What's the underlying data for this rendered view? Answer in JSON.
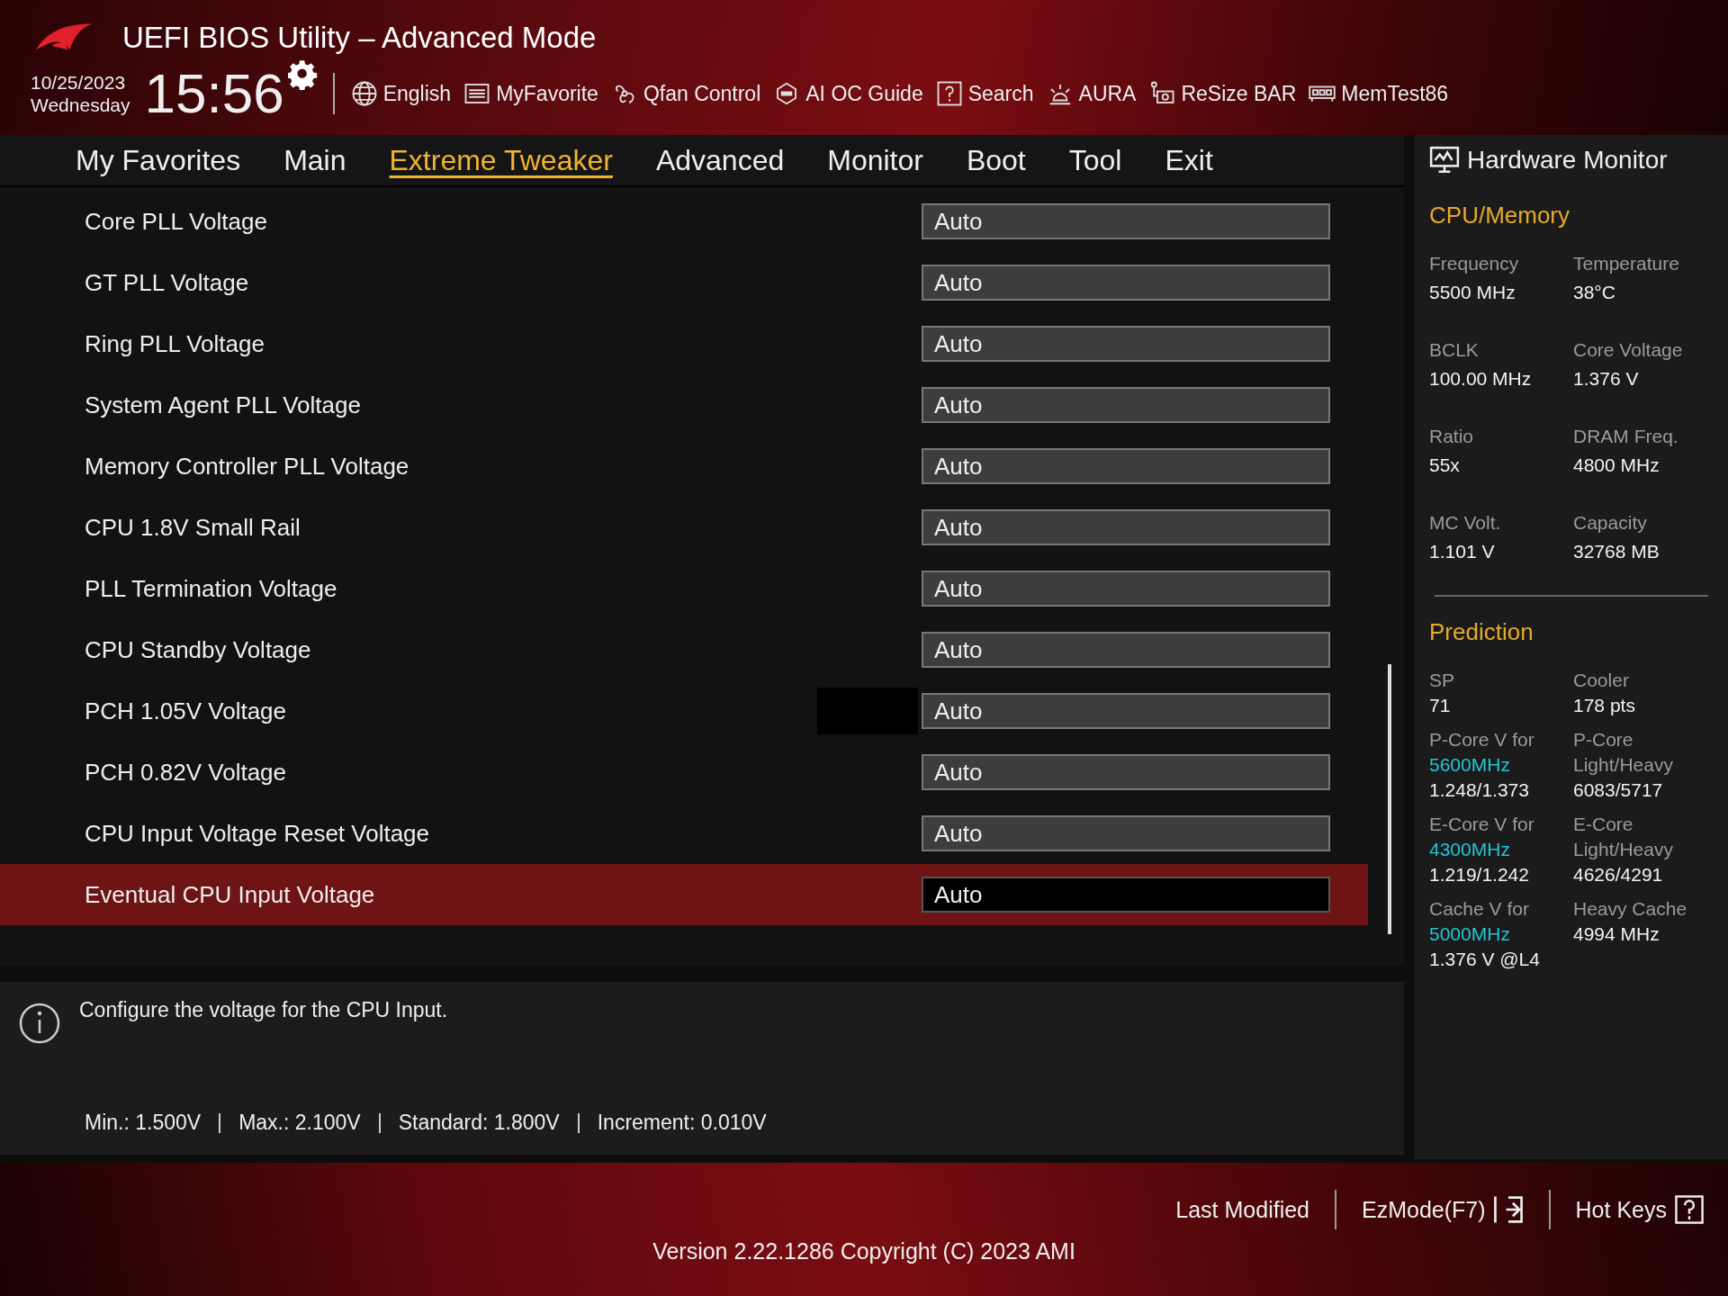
{
  "header": {
    "title": "UEFI BIOS Utility – Advanced Mode",
    "date": "10/25/2023",
    "weekday": "Wednesday",
    "time": "15:56",
    "tools": [
      {
        "kind": "globe",
        "label": "English"
      },
      {
        "kind": "list",
        "label": "MyFavorite"
      },
      {
        "kind": "fan",
        "label": "Qfan Control"
      },
      {
        "kind": "chip",
        "label": "AI OC Guide"
      },
      {
        "kind": "help",
        "label": "Search"
      },
      {
        "kind": "light",
        "label": "AURA"
      },
      {
        "kind": "card",
        "label": "ReSize BAR"
      },
      {
        "kind": "memory",
        "label": "MemTest86"
      }
    ]
  },
  "tabs": [
    {
      "label": "My Favorites",
      "selected": false
    },
    {
      "label": "Main",
      "selected": false
    },
    {
      "label": "Extreme Tweaker",
      "selected": true
    },
    {
      "label": "Advanced",
      "selected": false
    },
    {
      "label": "Monitor",
      "selected": false
    },
    {
      "label": "Boot",
      "selected": false
    },
    {
      "label": "Tool",
      "selected": false
    },
    {
      "label": "Exit",
      "selected": false
    }
  ],
  "settings": [
    {
      "label": "Core PLL Voltage",
      "value": "Auto",
      "selected": false
    },
    {
      "label": "GT PLL Voltage",
      "value": "Auto",
      "selected": false
    },
    {
      "label": "Ring PLL Voltage",
      "value": "Auto",
      "selected": false
    },
    {
      "label": "System Agent PLL Voltage",
      "value": "Auto",
      "selected": false
    },
    {
      "label": "Memory Controller PLL Voltage",
      "value": "Auto",
      "selected": false
    },
    {
      "label": "CPU 1.8V Small Rail",
      "value": "Auto",
      "selected": false
    },
    {
      "label": "PLL Termination Voltage",
      "value": "Auto",
      "selected": false
    },
    {
      "label": "CPU Standby Voltage",
      "value": "Auto",
      "selected": false
    },
    {
      "label": "PCH 1.05V Voltage",
      "value": "Auto",
      "selected": false
    },
    {
      "label": "PCH 0.82V Voltage",
      "value": "Auto",
      "selected": false
    },
    {
      "label": "CPU Input Voltage Reset Voltage",
      "value": "Auto",
      "selected": false
    },
    {
      "label": "Eventual CPU Input Voltage",
      "value": "Auto",
      "selected": true
    }
  ],
  "help": {
    "text": "Configure the voltage for the CPU Input.",
    "limits": [
      "Min.: 1.500V",
      "Max.: 2.100V",
      "Standard: 1.800V",
      "Increment: 0.010V"
    ]
  },
  "hardware_monitor": {
    "title": "Hardware Monitor",
    "sections": [
      {
        "title": "CPU/Memory",
        "items": [
          {
            "label": "Frequency",
            "value": "5500 MHz"
          },
          {
            "label": "Temperature",
            "value": "38°C"
          },
          {
            "label": "BCLK",
            "value": "100.00 MHz"
          },
          {
            "label": "Core Voltage",
            "value": "1.376 V"
          },
          {
            "label": "Ratio",
            "value": "55x"
          },
          {
            "label": "DRAM Freq.",
            "value": "4800 MHz"
          },
          {
            "label": "MC Volt.",
            "value": "1.101 V"
          },
          {
            "label": "Capacity",
            "value": "32768 MB"
          }
        ]
      },
      {
        "title": "Prediction",
        "items": [
          {
            "label": "SP",
            "value": "71"
          },
          {
            "label": "Cooler",
            "value": "178 pts"
          },
          {
            "label": "P-Core V for",
            "accent": "5600MHz",
            "value": "1.248/1.373"
          },
          {
            "label": "P-Core",
            "label_2": "Light/Heavy",
            "value": "6083/5717"
          },
          {
            "label": "E-Core V for",
            "accent": "4300MHz",
            "value": "1.219/1.242"
          },
          {
            "label": "E-Core",
            "label_2": "Light/Heavy",
            "value": "4626/4291"
          },
          {
            "label": "Cache V for",
            "accent": "5000MHz",
            "value": "1.376 V @L4"
          },
          {
            "label": "Heavy Cache",
            "value": "4994 MHz"
          }
        ]
      }
    ]
  },
  "footer": {
    "actions": [
      {
        "kind": "plain",
        "label": "Last Modified"
      },
      {
        "kind": "exit",
        "label": "EzMode(F7)"
      },
      {
        "kind": "help",
        "label": "Hot Keys"
      }
    ],
    "version": "Version 2.22.1286 Copyright (C) 2023 AMI"
  }
}
